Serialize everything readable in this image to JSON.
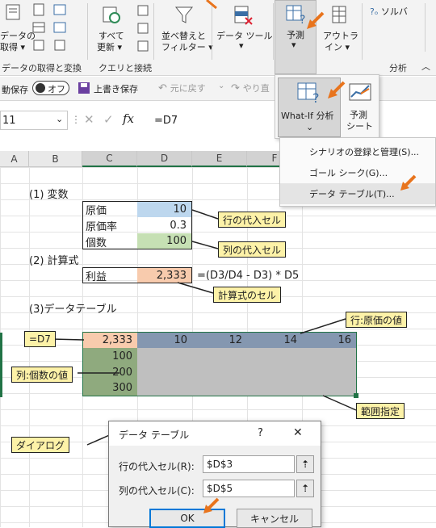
{
  "ribbon": {
    "get_data_line1": "データの",
    "get_data_line2": "取得 ▾",
    "refresh_line1": "すべて",
    "refresh_line2": "更新 ▾",
    "sort_filter_line1": "並べ替えと",
    "sort_filter_line2": "フィルター ▾",
    "data_tools_line1": "データ ツール",
    "data_tools_line2": "▾",
    "forecast_line1": "予測",
    "forecast_line2": "▾",
    "outline_line1": "アウトラ",
    "outline_line2": "イン ▾",
    "solver": "ソルバ",
    "group_get_transform": "データの取得と変換",
    "group_queries": "クエリと接続",
    "group_analysis": "分析"
  },
  "qat": {
    "autosave": "動保存",
    "toggle_state": "オフ",
    "save_label": "上書き保存",
    "undo_label": "元に戻す",
    "redo_label": "やり直"
  },
  "formula_bar": {
    "name_box": "11",
    "formula": "=D7"
  },
  "forecast_panel": {
    "whatif_label": "What-If 分析",
    "forecast_sheet_line1": "予測",
    "forecast_sheet_line2": "シート"
  },
  "whatif_menu": {
    "items": [
      "シナリオの登録と管理(S)...",
      "ゴール シーク(G)...",
      "データ テーブル(T)..."
    ]
  },
  "columns": [
    "A",
    "B",
    "C",
    "D",
    "E",
    "F"
  ],
  "sheet": {
    "sec1": "(1) 変数",
    "cost_label": "原価",
    "cost_value": "10",
    "rate_label": "原価率",
    "rate_value": "0.3",
    "qty_label": "個数",
    "qty_value": "100",
    "sec2": "(2) 計算式",
    "profit_label": "利益",
    "profit_value": "2,333",
    "profit_formula": "=(D3/D4 - D3) * D5",
    "sec3": "(3)データテーブル",
    "table_corner": "2,333",
    "row_headers": [
      "10",
      "12",
      "14",
      "16"
    ],
    "col_headers": [
      "100",
      "200",
      "300"
    ]
  },
  "callouts": {
    "row_input": "行の代入セル",
    "col_input": "列の代入セル",
    "formula_cell": "計算式のセル",
    "d7": "=D7",
    "row_original": "行:原価の値",
    "col_qty": "列:個数の値",
    "range": "範囲指定",
    "dialog": "ダイアログ"
  },
  "dialog": {
    "title": "データ テーブル",
    "help": "?",
    "close": "✕",
    "row_label": "行の代入セル(R):",
    "row_value": "$D$3",
    "col_label": "列の代入セル(C):",
    "col_value": "$D$5",
    "ok": "OK",
    "cancel": "キャンセル"
  },
  "colors": {
    "blue_fill": "#bdd7ee",
    "green_fill": "#c6e0b4",
    "orange_fill": "#f8cbad",
    "table_header": "#8497b0",
    "table_left": "#8faa7e",
    "table_body": "#bfbfbf",
    "callout": "#fdf2a8",
    "arrow": "#e8741d"
  }
}
